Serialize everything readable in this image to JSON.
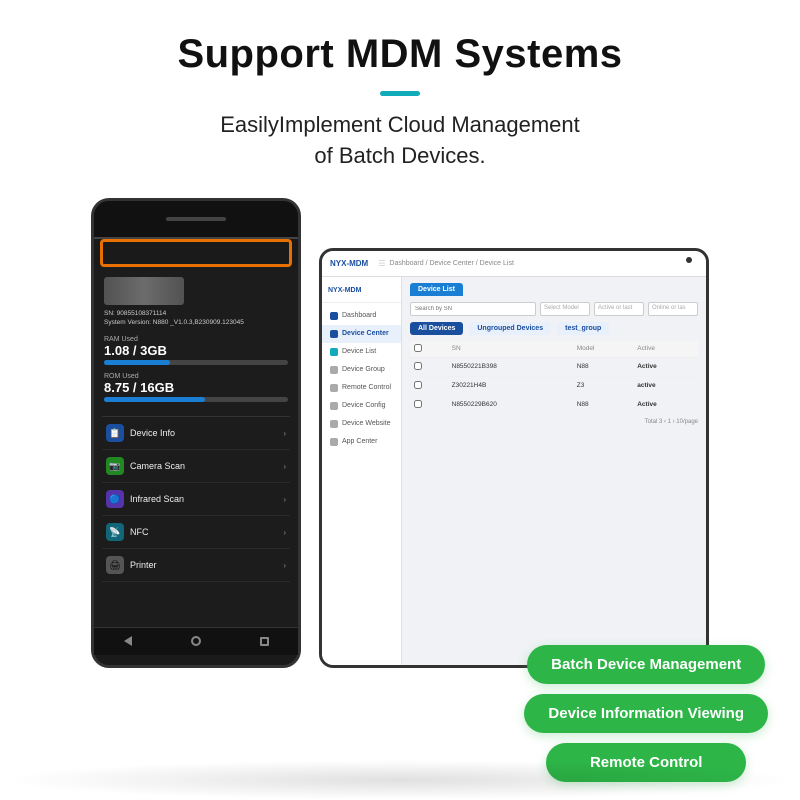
{
  "header": {
    "title": "Support MDM Systems",
    "subtitle_line1": "EasilyImplement Cloud Management",
    "subtitle_line2": "of Batch Devices."
  },
  "mobile": {
    "sn": "SN: 90855108371114",
    "system_version": "System Version: N880 _V1.0.3,B230909.123045",
    "ram_label": "RAM Used",
    "ram_value": "1.08 / 3GB",
    "ram_fill_pct": 36,
    "rom_label": "ROM Used",
    "rom_value": "8.75 / 16GB",
    "rom_fill_pct": 55,
    "menu_items": [
      {
        "label": "Device Info",
        "icon": "📋",
        "icon_class": "menu-icon-blue"
      },
      {
        "label": "Camera Scan",
        "icon": "📷",
        "icon_class": "menu-icon-green"
      },
      {
        "label": "Infrared Scan",
        "icon": "🔵",
        "icon_class": "menu-icon-purple"
      },
      {
        "label": "NFC",
        "icon": "📡",
        "icon_class": "menu-icon-teal"
      },
      {
        "label": "Printer",
        "icon": "🖨",
        "icon_class": "menu-icon-gray"
      }
    ]
  },
  "tablet": {
    "logo": "NYX-MDM",
    "breadcrumb": "Dashboard / Device Center / Device List",
    "sidebar": {
      "items": [
        {
          "label": "Dashboard",
          "icon_class": "blue"
        },
        {
          "label": "Device Center",
          "icon_class": "blue",
          "active": true
        },
        {
          "label": "Device List",
          "icon_class": "teal"
        },
        {
          "label": "Device Group",
          "icon_class": ""
        },
        {
          "label": "Remote Control",
          "icon_class": ""
        },
        {
          "label": "Device Config",
          "icon_class": ""
        },
        {
          "label": "Device Website",
          "icon_class": ""
        },
        {
          "label": "App Center",
          "icon_class": ""
        }
      ]
    },
    "tab_label": "Device List",
    "filter_placeholder": "Search by SN",
    "filter_model_placeholder": "Select Model",
    "filter_active_placeholder": "Active or last",
    "filter_online_placeholder": "Online or las",
    "device_groups": [
      "All Devices",
      "Ungrouped Devices",
      "test_group"
    ],
    "table_headers": [
      "",
      "SN",
      "Model",
      "Active"
    ],
    "table_rows": [
      {
        "sn": "N8550221B398",
        "model": "N88",
        "active": "Active"
      },
      {
        "sn": "Z30221H4B",
        "model": "Z3",
        "active": "active"
      },
      {
        "sn": "N8550229B620",
        "model": "N88",
        "active": "Active"
      }
    ],
    "pagination": "Total 3    ‹    1    ›    10/page"
  },
  "features": {
    "btn1": "Batch Device Management",
    "btn2": "Device Information Viewing",
    "btn3": "Remote Control"
  }
}
